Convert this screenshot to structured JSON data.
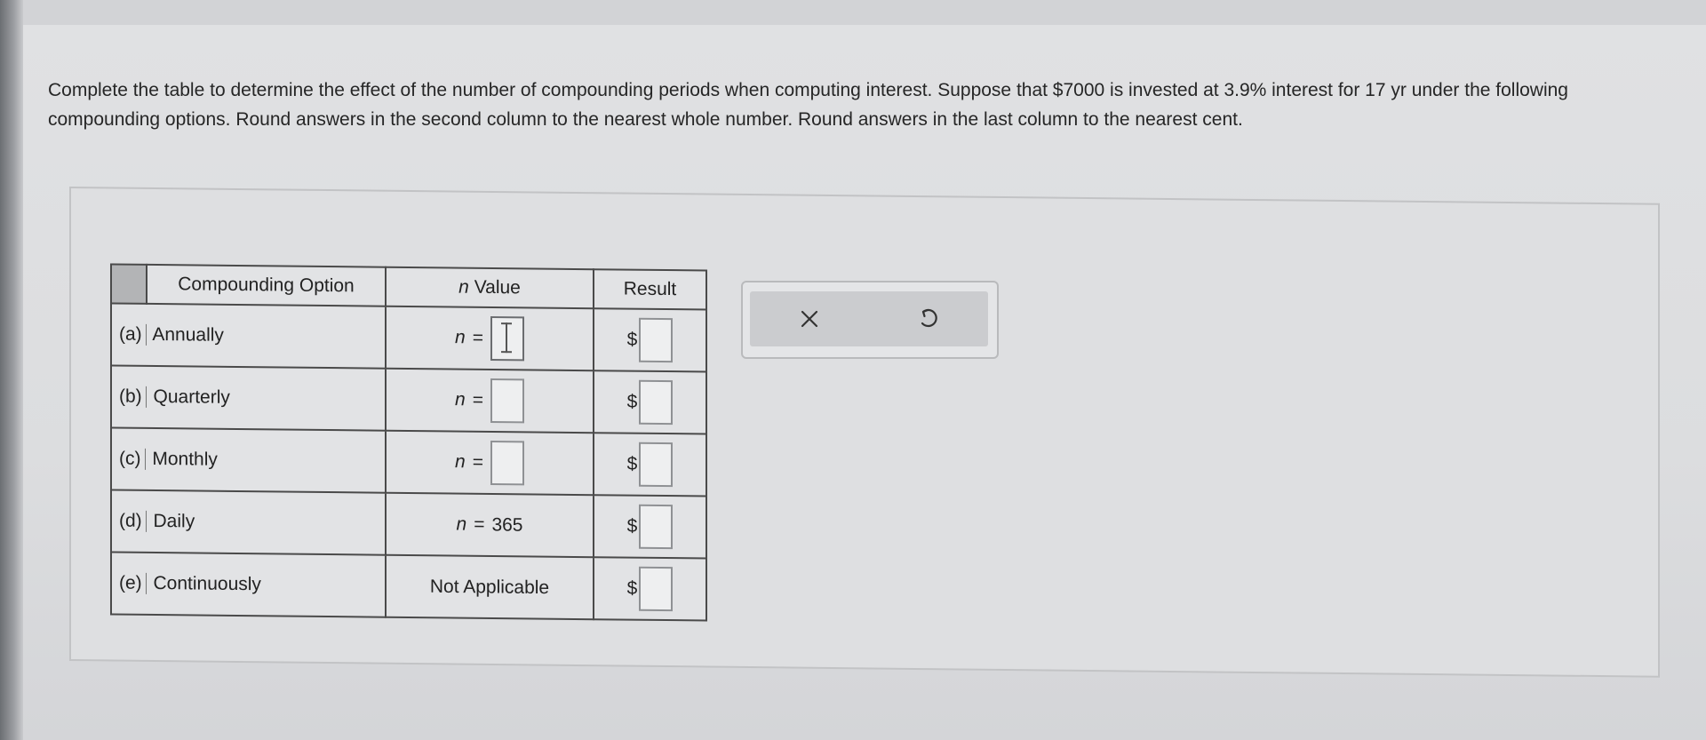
{
  "instructions": {
    "text": "Complete the table to determine the effect of the number of compounding periods when computing interest. Suppose that $7000 is invested at 3.9% interest for 17 yr under the following compounding options. Round answers in the second column to the nearest whole number. Round answers in the last column to the nearest cent."
  },
  "table": {
    "headers": {
      "option": "Compounding Option",
      "n_value": "n Value",
      "result": "Result"
    },
    "n_label": "n",
    "equals": "=",
    "currency": "$",
    "rows": [
      {
        "letter": "(a)",
        "option": "Annually",
        "n_fixed": ""
      },
      {
        "letter": "(b)",
        "option": "Quarterly",
        "n_fixed": ""
      },
      {
        "letter": "(c)",
        "option": "Monthly",
        "n_fixed": ""
      },
      {
        "letter": "(d)",
        "option": "Daily",
        "n_fixed": "365"
      },
      {
        "letter": "(e)",
        "option": "Continuously",
        "n_text": "Not Applicable"
      }
    ]
  },
  "toolbar": {
    "clear_icon": "close-icon",
    "undo_icon": "undo-icon"
  }
}
